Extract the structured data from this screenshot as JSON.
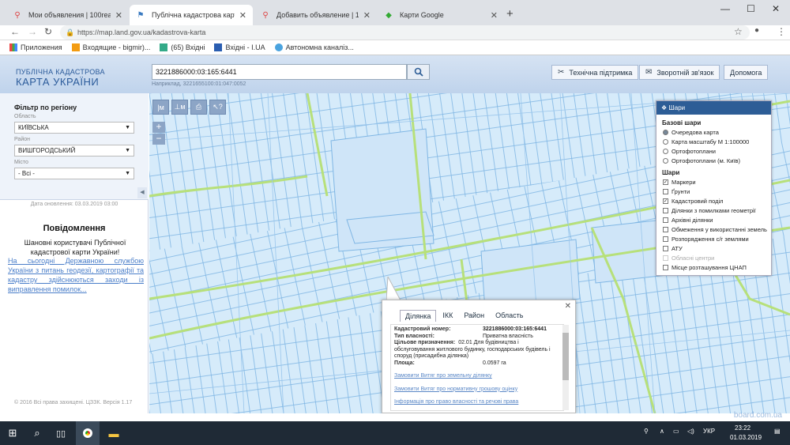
{
  "browser": {
    "tabs": [
      {
        "label": "Мои объявления | 100realty.ua",
        "icon": "map-pin-icon",
        "active": false
      },
      {
        "label": "Публічна кадастрова карта Укр",
        "icon": "flag-icon",
        "active": true
      },
      {
        "label": "Добавить объявление | 100realt",
        "icon": "map-pin-icon",
        "active": false
      },
      {
        "label": "Карти Google",
        "icon": "google-maps-icon",
        "active": false
      }
    ],
    "url": "https://map.land.gov.ua/kadastrova-karta",
    "bookmarks": [
      "Приложения",
      "Входящие - bigmir)...",
      "(65) Вхідні",
      "Вхідні - I.UA",
      "Автономна каналіз..."
    ]
  },
  "header": {
    "brand_line1": "ПУБЛІЧНА КАДАСТРОВА",
    "brand_line2": "КАРТА УКРАЇНИ",
    "search_value": "3221886000:03:165:6441",
    "search_hint": "Наприклад, 3221655100:01:047:0052",
    "buttons": {
      "support": "Технічна підтримка",
      "feedback": "Зворотній зв'язок",
      "help": "Допомога"
    }
  },
  "sidebar": {
    "filter_title": "Фільтр по регіону",
    "region_label": "Область",
    "region_value": "КИЇВСЬКА",
    "district_label": "Район",
    "district_value": "ВИШГОРОДСЬКИЙ",
    "city_label": "Місто",
    "city_value": "- Всі -",
    "updated": "Дата оновлення: 03.03.2019 03:00",
    "notice_title": "Повідомлення",
    "notice_text": "Шановні користувачі Публічної кадастрової карти України!",
    "notice_link": "На сьогодні Державною службою України з питань геодезії, картографії та кадастру здійснюються заходи із виправлення помилок...",
    "copyright": "© 2016 Всі права захищені. ЦЗЗК. Версія 1.17"
  },
  "layers": {
    "title": "Шари",
    "base_title": "Базові шари",
    "base": [
      {
        "label": "Oчередова карта",
        "checked": true
      },
      {
        "label": "Карта масштабу М 1:100000",
        "checked": false
      },
      {
        "label": "Ортофотоплани",
        "checked": false
      },
      {
        "label": "Ортофотоплани (м. Київ)",
        "checked": false
      }
    ],
    "overlays_title": "Шари",
    "overlays": [
      {
        "label": "Маркери",
        "checked": true,
        "disabled": false
      },
      {
        "label": "Ґрунти",
        "checked": false,
        "disabled": false
      },
      {
        "label": "Кадастровий поділ",
        "checked": true,
        "disabled": false
      },
      {
        "label": "Ділянки з помилками геометрії",
        "checked": false,
        "disabled": false
      },
      {
        "label": "Архівні ділянки",
        "checked": false,
        "disabled": false
      },
      {
        "label": "Обмеження у використанні земель",
        "checked": false,
        "disabled": false
      },
      {
        "label": "Розпорядження с/г землями",
        "checked": false,
        "disabled": false
      },
      {
        "label": "АТУ",
        "checked": false,
        "disabled": false
      },
      {
        "label": "Обласні центри",
        "checked": false,
        "disabled": true
      },
      {
        "label": "Місце розташування ЦНАП",
        "checked": false,
        "disabled": false
      }
    ]
  },
  "popup": {
    "tabs": [
      "Ділянка",
      "ІКК",
      "Район",
      "Область"
    ],
    "fields": [
      {
        "k": "Кадастровий номер:",
        "v": "3221886000:03:165:6441"
      },
      {
        "k": "Тип власності:",
        "v": "Приватна власність"
      },
      {
        "k": "Цільове призначення:",
        "v": "02.01 Для будівництва і обслуговування житлового будинку, господарських будівель і споруд (присадибна ділянка)"
      },
      {
        "k": "Площа:",
        "v": "0.0597 га"
      }
    ],
    "links": [
      "Замовити Витяг про земельну ділянку",
      "Замовити Витяг про нормативну грошову оцінку",
      "Інформація про право власності та речові права"
    ]
  },
  "taskbar": {
    "lang": "УКР",
    "time": "23:22",
    "date": "01.03.2019"
  },
  "watermark": "board.com.ua"
}
